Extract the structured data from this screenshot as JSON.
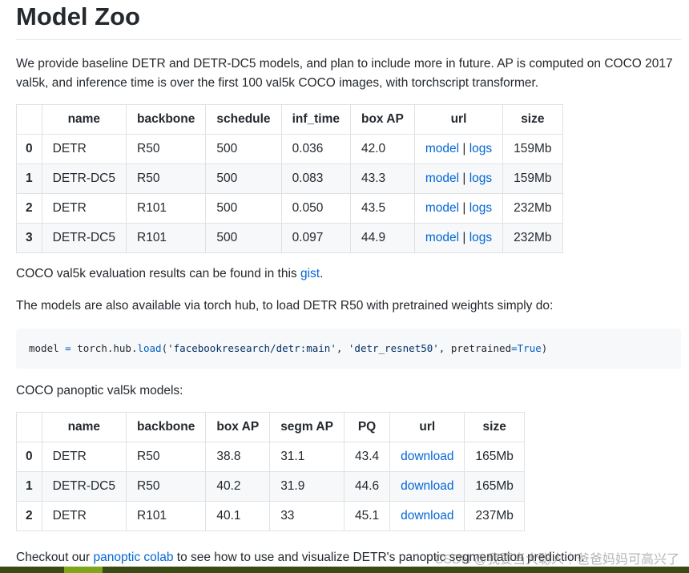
{
  "title": "Model Zoo",
  "intro": "We provide baseline DETR and DETR-DC5 models, and plan to include more in future. AP is computed on COCO 2017 val5k, and inference time is over the first 100 val5k COCO images, with torchscript transformer.",
  "table1": {
    "headers": [
      "",
      "name",
      "backbone",
      "schedule",
      "inf_time",
      "box AP",
      "url",
      "size"
    ],
    "rows": [
      {
        "idx": "0",
        "name": "DETR",
        "backbone": "R50",
        "schedule": "500",
        "inf_time": "0.036",
        "box_ap": "42.0",
        "size": "159Mb"
      },
      {
        "idx": "1",
        "name": "DETR-DC5",
        "backbone": "R50",
        "schedule": "500",
        "inf_time": "0.083",
        "box_ap": "43.3",
        "size": "159Mb"
      },
      {
        "idx": "2",
        "name": "DETR",
        "backbone": "R101",
        "schedule": "500",
        "inf_time": "0.050",
        "box_ap": "43.5",
        "size": "232Mb"
      },
      {
        "idx": "3",
        "name": "DETR-DC5",
        "backbone": "R101",
        "schedule": "500",
        "inf_time": "0.097",
        "box_ap": "44.9",
        "size": "232Mb"
      }
    ],
    "model_link": "model",
    "sep": "|",
    "logs_link": "logs"
  },
  "gist_text": "COCO val5k evaluation results can be found in this",
  "gist_link": "gist",
  "gist_end": ".",
  "hub_text": "The models are also available via torch hub, to load DETR R50 with pretrained weights simply do:",
  "code": {
    "p1": "model ",
    "eq1": "=",
    "p2": " torch.hub.",
    "fn": "load",
    "p3": "(",
    "s1": "'facebookresearch/detr:main'",
    "p4": ", ",
    "s2": "'detr_resnet50'",
    "p5": ", pretrained",
    "eq2": "=",
    "kw": "True",
    "p6": ")"
  },
  "panoptic_text": "COCO panoptic val5k models:",
  "table2": {
    "headers": [
      "",
      "name",
      "backbone",
      "box AP",
      "segm AP",
      "PQ",
      "url",
      "size"
    ],
    "rows": [
      {
        "idx": "0",
        "name": "DETR",
        "backbone": "R50",
        "box_ap": "38.8",
        "segm_ap": "31.1",
        "pq": "43.4",
        "url": "download",
        "size": "165Mb"
      },
      {
        "idx": "1",
        "name": "DETR-DC5",
        "backbone": "R50",
        "box_ap": "40.2",
        "segm_ap": "31.9",
        "pq": "44.6",
        "url": "download",
        "size": "165Mb"
      },
      {
        "idx": "2",
        "name": "DETR",
        "backbone": "R101",
        "box_ap": "40.1",
        "segm_ap": "33",
        "pq": "45.1",
        "url": "download",
        "size": "237Mb"
      }
    ]
  },
  "last_line": {
    "pre": "Checkout our ",
    "link": "panoptic colab",
    "post": " to see how to use and visualize DETR's panoptic segmentation prediction."
  },
  "watermark": "CSDN @我要当大聪人｜爸爸妈妈可高兴了"
}
